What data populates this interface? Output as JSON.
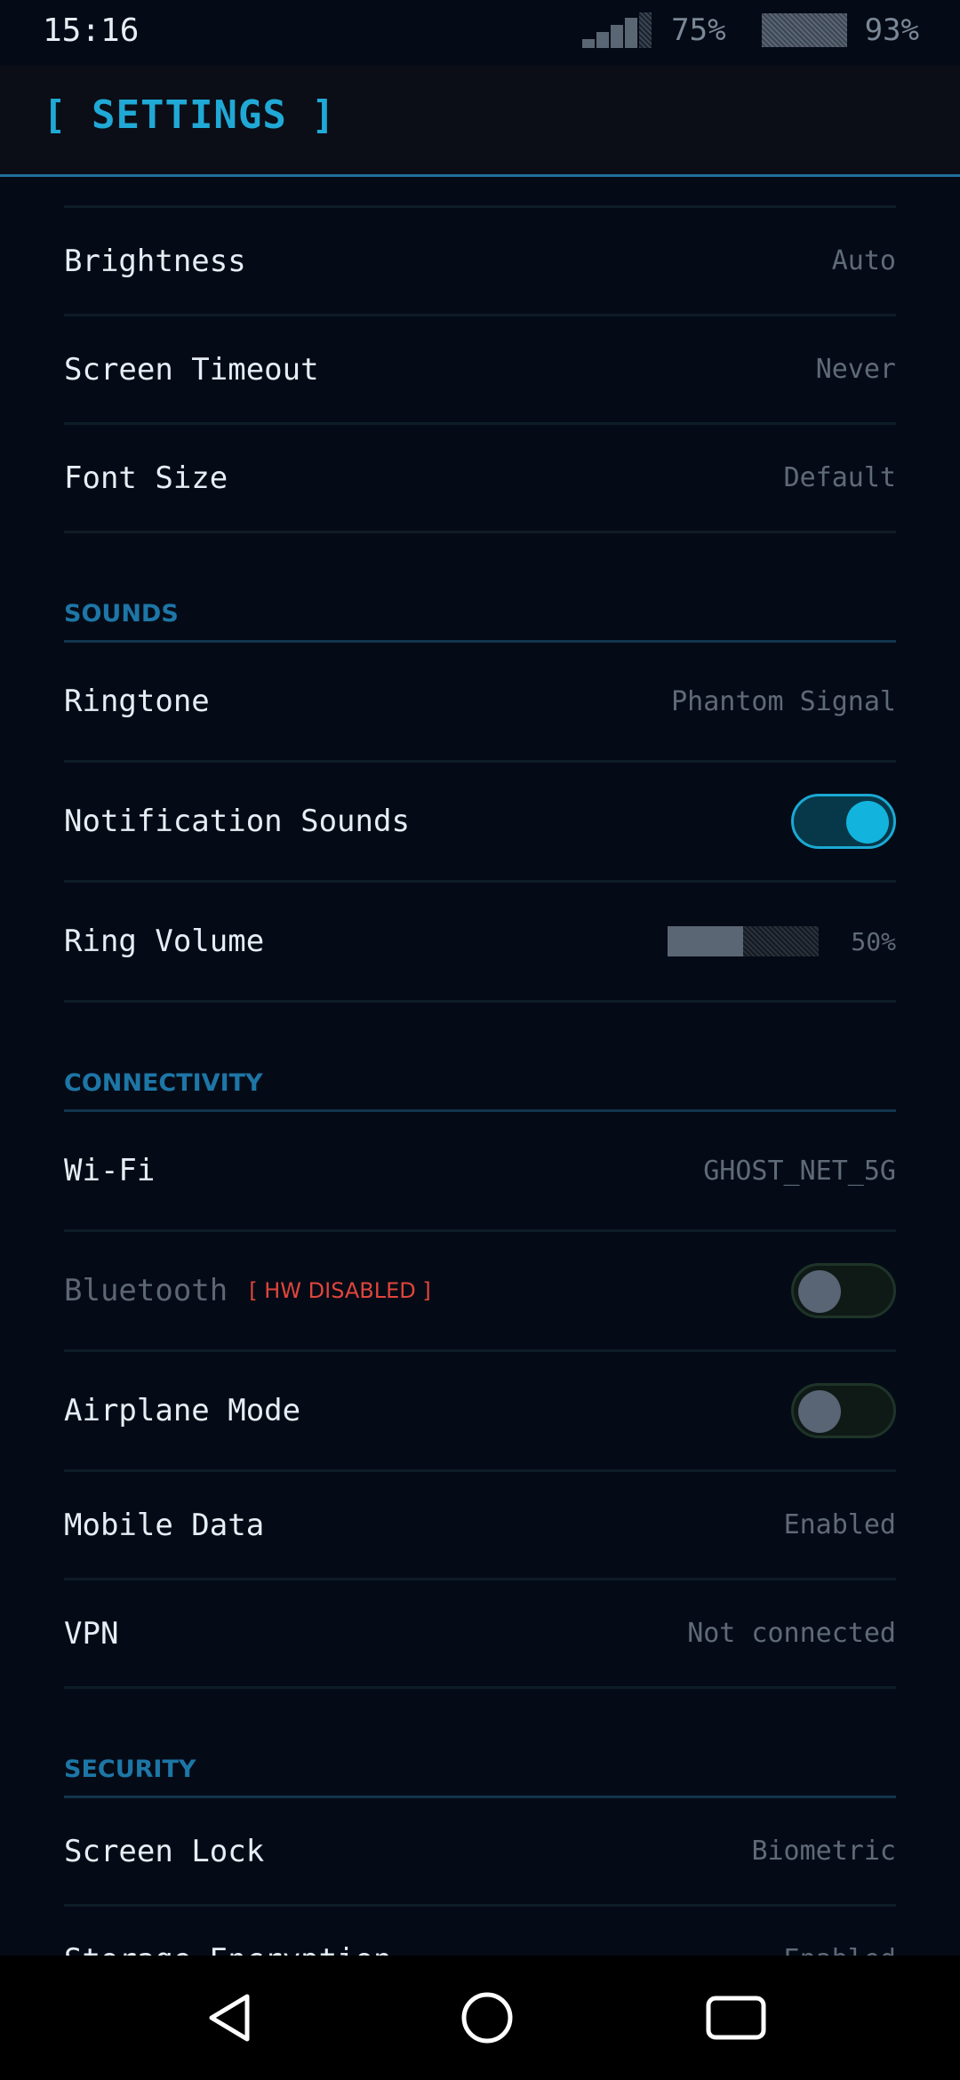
{
  "status": {
    "time": "15:16",
    "signal_percent": "75%",
    "battery_percent": "93%"
  },
  "app_bar": {
    "title": "[ SETTINGS ]"
  },
  "display": {
    "brightness": {
      "label": "Brightness",
      "value": "Auto"
    },
    "screen_timeout": {
      "label": "Screen Timeout",
      "value": "Never"
    },
    "font_size": {
      "label": "Font Size",
      "value": "Default"
    }
  },
  "sounds": {
    "header": "SOUNDS",
    "ringtone": {
      "label": "Ringtone",
      "value": "Phantom Signal"
    },
    "notification_sounds": {
      "label": "Notification Sounds",
      "enabled": true
    },
    "ring_volume": {
      "label": "Ring Volume",
      "value": "50%",
      "level": 0.5
    }
  },
  "connectivity": {
    "header": "CONNECTIVITY",
    "wifi": {
      "label": "Wi-Fi",
      "value": "GHOST_NET_5G"
    },
    "bluetooth": {
      "label": "Bluetooth",
      "badge": "[ HW DISABLED ]",
      "enabled": false
    },
    "airplane_mode": {
      "label": "Airplane Mode",
      "enabled": false
    },
    "mobile_data": {
      "label": "Mobile Data",
      "value": "Enabled"
    },
    "vpn": {
      "label": "VPN",
      "value": "Not connected"
    }
  },
  "security": {
    "header": "SECURITY",
    "screen_lock": {
      "label": "Screen Lock",
      "value": "Biometric"
    },
    "storage_encryption": {
      "label": "Storage Encryption",
      "value": "Enabled"
    }
  },
  "nav": {
    "back_icon": "triangle-back",
    "home_icon": "circle-home",
    "recents_icon": "square-recents"
  },
  "colors": {
    "accent": "#20a9d6",
    "section": "#1d76a6",
    "warning": "#e0453c",
    "background": "#050b16"
  }
}
